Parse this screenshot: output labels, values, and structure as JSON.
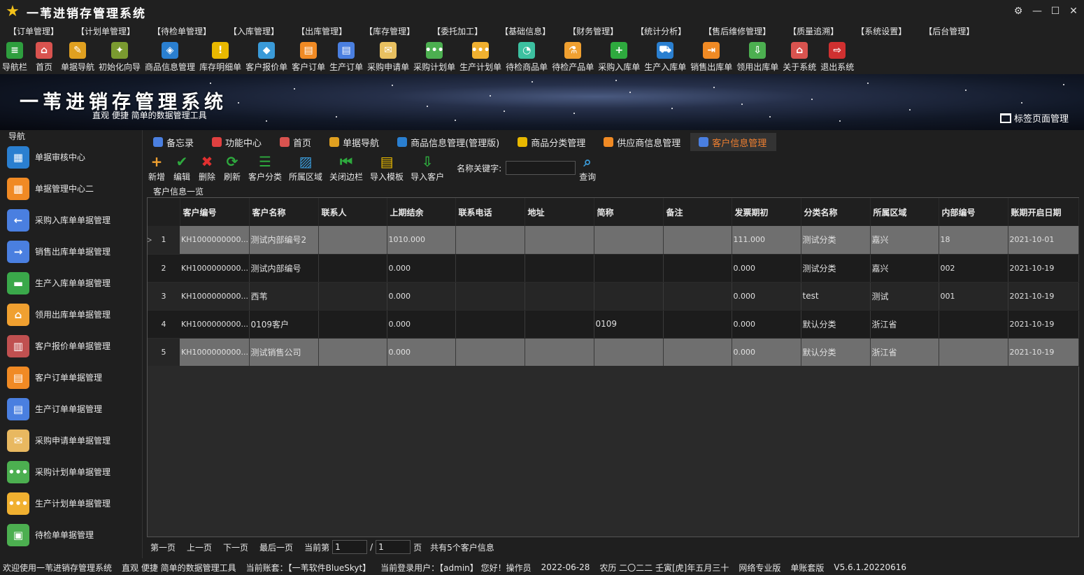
{
  "window": {
    "title": "一苇进销存管理系统"
  },
  "menu": [
    "【订单管理】",
    "【计划单管理】",
    "【待检单管理】",
    "【入库管理】",
    "【出库管理】",
    "【库存管理】",
    "【委托加工】",
    "【基础信息】",
    "【财务管理】",
    "【统计分析】",
    "【售后维修管理】",
    "【质量追溯】",
    "【系统设置】",
    "【后台管理】"
  ],
  "toolbar": [
    {
      "label": "导航栏",
      "icon": "menu-icon",
      "color": "#2e9e3e",
      "glyph": "≡"
    },
    {
      "label": "首页",
      "icon": "home-icon",
      "color": "#d9534f",
      "glyph": "⌂"
    },
    {
      "label": "单据导航",
      "icon": "navigate-icon",
      "color": "#e0a020",
      "glyph": "✎"
    },
    {
      "label": "初始化向导",
      "icon": "wand-icon",
      "color": "#7a9a30",
      "glyph": "✦"
    },
    {
      "label": "商品信息管理",
      "icon": "cubes-icon",
      "color": "#2a7fd0",
      "glyph": "◈"
    },
    {
      "label": "库存明细单",
      "icon": "warning-icon",
      "color": "#e8b800",
      "glyph": "!"
    },
    {
      "label": "客户报价单",
      "icon": "tag-icon",
      "color": "#3a9ad8",
      "glyph": "◆"
    },
    {
      "label": "客户订单",
      "icon": "order-icon",
      "color": "#f08a24",
      "glyph": "▤"
    },
    {
      "label": "生产订单",
      "icon": "production-order-icon",
      "color": "#4a7fe0",
      "glyph": "▤"
    },
    {
      "label": "采购申请单",
      "icon": "purchase-request-icon",
      "color": "#e8c060",
      "glyph": "✉"
    },
    {
      "label": "采购计划单",
      "icon": "purchase-plan-icon",
      "color": "#4caf50",
      "glyph": "•••"
    },
    {
      "label": "生产计划单",
      "icon": "production-plan-icon",
      "color": "#f0b030",
      "glyph": "•••"
    },
    {
      "label": "待检商品单",
      "icon": "pending-goods-icon",
      "color": "#3cc0a0",
      "glyph": "◔"
    },
    {
      "label": "待检产品单",
      "icon": "flask-icon",
      "color": "#f0a030",
      "glyph": "⚗"
    },
    {
      "label": "采购入库单",
      "icon": "add-icon",
      "color": "#2eaa3e",
      "glyph": "+"
    },
    {
      "label": "生产入库单",
      "icon": "cart-icon",
      "color": "#2a7fd0",
      "glyph": "⛟"
    },
    {
      "label": "销售出库单",
      "icon": "export-icon",
      "color": "#f08a24",
      "glyph": "⇥"
    },
    {
      "label": "领用出库单",
      "icon": "download-icon",
      "color": "#4caf50",
      "glyph": "⇩"
    },
    {
      "label": "关于系统",
      "icon": "about-icon",
      "color": "#d9534f",
      "glyph": "⌂"
    },
    {
      "label": "退出系统",
      "icon": "exit-icon",
      "color": "#d03030",
      "glyph": "⇨"
    }
  ],
  "banner": {
    "title": "一苇进销存管理系统",
    "subtitle": "直观 便捷 简单的数据管理工具",
    "tag_manager": "标签页面管理"
  },
  "nav": {
    "header": "导航",
    "items": [
      {
        "label": "单据审核中心",
        "icon": "audit-center-icon",
        "color": "#2a7fd0",
        "glyph": "▦"
      },
      {
        "label": "单据管理中心二",
        "icon": "manage-center-icon",
        "color": "#f08a24",
        "glyph": "▦"
      },
      {
        "label": "采购入库单单据管理",
        "icon": "purchase-in-icon",
        "color": "#4a7fe0",
        "glyph": "←"
      },
      {
        "label": "销售出库单单据管理",
        "icon": "sales-out-icon",
        "color": "#4a7fe0",
        "glyph": "→"
      },
      {
        "label": "生产入库单单据管理",
        "icon": "production-in-icon",
        "color": "#3aa84a",
        "glyph": "▬"
      },
      {
        "label": "领用出库单单据管理",
        "icon": "use-out-icon",
        "color": "#f0a030",
        "glyph": "⌂"
      },
      {
        "label": "客户报价单单据管理",
        "icon": "quote-icon",
        "color": "#c05050",
        "glyph": "▥"
      },
      {
        "label": "客户订单单据管理",
        "icon": "customer-order-icon",
        "color": "#f08a24",
        "glyph": "▤"
      },
      {
        "label": "生产订单单据管理",
        "icon": "production-order-doc-icon",
        "color": "#4a7fe0",
        "glyph": "▤"
      },
      {
        "label": "采购申请单单据管理",
        "icon": "purchase-request-doc-icon",
        "color": "#e8b860",
        "glyph": "✉"
      },
      {
        "label": "采购计划单单据管理",
        "icon": "purchase-plan-doc-icon",
        "color": "#4caf50",
        "glyph": "•••"
      },
      {
        "label": "生产计划单单据管理",
        "icon": "production-plan-doc-icon",
        "color": "#f0b030",
        "glyph": "•••"
      },
      {
        "label": "待检单单据管理",
        "icon": "inspection-doc-icon",
        "color": "#4caf50",
        "glyph": "▣"
      }
    ]
  },
  "tabs": [
    {
      "label": "备忘录",
      "icon": "memo-icon",
      "color": "#4a7fe0"
    },
    {
      "label": "功能中心",
      "icon": "function-center-icon",
      "color": "#e04040"
    },
    {
      "label": "首页",
      "icon": "home-tab-icon",
      "color": "#d9534f"
    },
    {
      "label": "单据导航",
      "icon": "nav-tab-icon",
      "color": "#e0a020"
    },
    {
      "label": "商品信息管理(管理版)",
      "icon": "goods-tab-icon",
      "color": "#2a7fd0"
    },
    {
      "label": "商品分类管理",
      "icon": "category-tab-icon",
      "color": "#e8b800"
    },
    {
      "label": "供应商信息管理",
      "icon": "supplier-tab-icon",
      "color": "#f08a24"
    },
    {
      "label": "客户信息管理",
      "icon": "customer-tab-icon",
      "color": "#4a7fe0"
    }
  ],
  "actions": [
    {
      "label": "新增",
      "icon": "add-icon",
      "color": "#f0a030",
      "glyph": "+"
    },
    {
      "label": "编辑",
      "icon": "check-icon",
      "color": "#2eaa3e",
      "glyph": "✔"
    },
    {
      "label": "删除",
      "icon": "delete-icon",
      "color": "#e03030",
      "glyph": "✖"
    },
    {
      "label": "刷新",
      "icon": "refresh-icon",
      "color": "#2eaa3e",
      "glyph": "⟳"
    },
    {
      "label": "客户分类",
      "icon": "list-icon",
      "color": "#2eaa3e",
      "glyph": "☰"
    },
    {
      "label": "所属区域",
      "icon": "region-icon",
      "color": "#3a9ad8",
      "glyph": "▨"
    },
    {
      "label": "关闭边栏",
      "icon": "sidebar-close-icon",
      "color": "#2eaa3e",
      "glyph": "⏮"
    },
    {
      "label": "导入模板",
      "icon": "template-icon",
      "color": "#e8b800",
      "glyph": "▤"
    },
    {
      "label": "导入客户",
      "icon": "import-icon",
      "color": "#2eaa3e",
      "glyph": "⇩"
    }
  ],
  "search": {
    "label": "名称关键字:",
    "value": "",
    "button": "查询"
  },
  "group_label": "客户信息一览",
  "table": {
    "columns": [
      "客户编号",
      "客户名称",
      "联系人",
      "上期结余",
      "联系电话",
      "地址",
      "简称",
      "备注",
      "发票期初",
      "分类名称",
      "所属区域",
      "内部编号",
      "账期开启日期"
    ],
    "rows": [
      {
        "n": "1",
        "cells": [
          "KH1000000000...",
          "测试内部编号2",
          "",
          "1010.000",
          "",
          "",
          "",
          "",
          "111.000",
          "测试分类",
          "嘉兴",
          "18",
          "2021-10-01"
        ]
      },
      {
        "n": "2",
        "cells": [
          "KH1000000000...",
          "测试内部编号",
          "",
          "0.000",
          "",
          "",
          "",
          "",
          "0.000",
          "测试分类",
          "嘉兴",
          "002",
          "2021-10-19"
        ]
      },
      {
        "n": "3",
        "cells": [
          "KH1000000000...",
          "西苇",
          "",
          "0.000",
          "",
          "",
          "",
          "",
          "0.000",
          "test",
          "测试",
          "001",
          "2021-10-19"
        ]
      },
      {
        "n": "4",
        "cells": [
          "KH1000000000...",
          "0109客户",
          "",
          "0.000",
          "",
          "",
          "0109",
          "",
          "0.000",
          "默认分类",
          "浙江省",
          "",
          "2021-10-19"
        ]
      },
      {
        "n": "5",
        "cells": [
          "KH1000000000...",
          "测试销售公司",
          "",
          "0.000",
          "",
          "",
          "",
          "",
          "0.000",
          "默认分类",
          "浙江省",
          "",
          "2021-10-19"
        ]
      }
    ]
  },
  "pager": {
    "first": "第一页",
    "prev": "上一页",
    "next": "下一页",
    "last": "最后一页",
    "current_label": "当前第",
    "current": "1",
    "sep": "/",
    "total": "1",
    "page_unit": "页",
    "summary": "共有5个客户信息"
  },
  "status": {
    "welcome": "欢迎使用一苇进销存管理系统",
    "slogan": "直观 便捷 简单的数据管理工具",
    "account": "当前账套：【一苇软件BlueSkyt】",
    "user": "当前登录用户：【admin】 您好！操作员",
    "date": "2022-06-28",
    "lunar": "农历 二〇二二 壬寅[虎]年五月三十",
    "edition": "网络专业版",
    "mode": "单账套版",
    "version": "V5.6.1.20220616"
  }
}
